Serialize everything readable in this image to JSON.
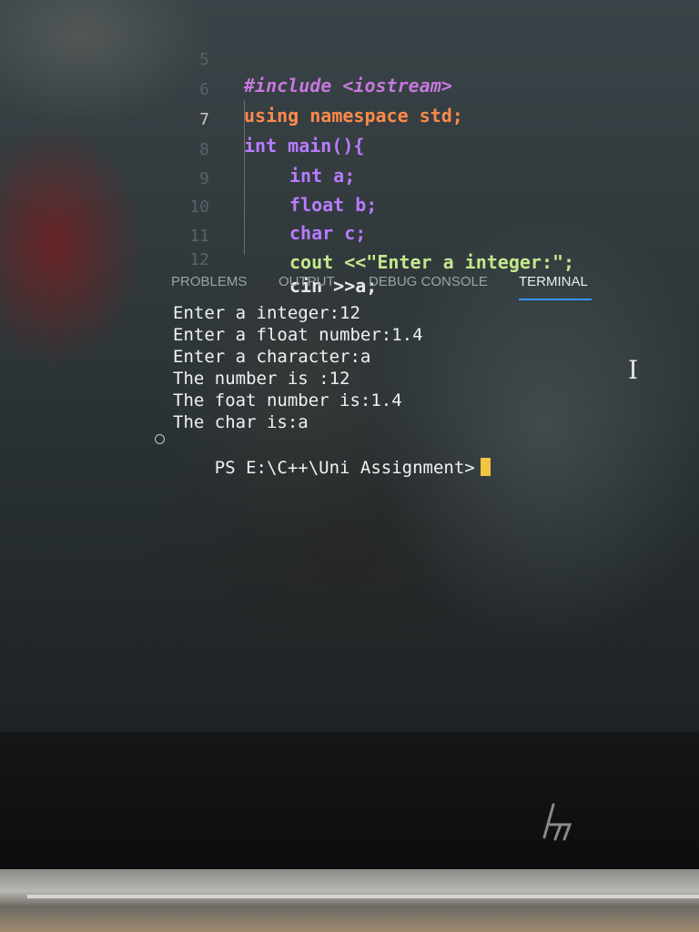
{
  "editor": {
    "lines": [
      {
        "number": "5",
        "text": "#include <iostream>"
      },
      {
        "number": "6",
        "text": "using namespace std;"
      },
      {
        "number": "7",
        "text": "int main(){"
      },
      {
        "number": "8",
        "text": "int a;"
      },
      {
        "number": "9",
        "text": "float b;"
      },
      {
        "number": "10",
        "text": "char c;"
      },
      {
        "number": "11",
        "text": "cout <<\"Enter a integer:\";"
      },
      {
        "number": "12",
        "text": "cin >>a;"
      }
    ],
    "active_line": "7"
  },
  "panel": {
    "tabs": [
      {
        "label": "PROBLEMS"
      },
      {
        "label": "OUTPUT"
      },
      {
        "label": "DEBUG CONSOLE"
      },
      {
        "label": "TERMINAL"
      }
    ],
    "active_tab": "TERMINAL"
  },
  "terminal": {
    "lines": [
      "Enter a integer:12",
      "Enter a float number:1.4",
      "Enter a character:a",
      "The number is :12",
      "The foat number is:1.4",
      "The char is:a"
    ],
    "prompt": "PS E:\\C++\\Uni Assignment>"
  },
  "colors": {
    "accent": "#3794ff",
    "cursor": "#f2c542"
  },
  "icons": [
    "ibeam-cursor-icon",
    "terminal-status-circle-icon",
    "hp-logo-icon"
  ]
}
